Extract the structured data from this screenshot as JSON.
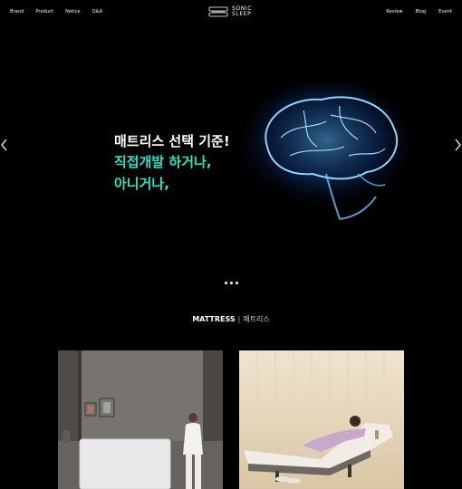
{
  "nav": {
    "left": [
      "Brand",
      "Product",
      "Notice",
      "Q&A"
    ],
    "right": [
      "Review",
      "Blog",
      "Event"
    ]
  },
  "logo": {
    "line1": "SONIC",
    "line2": "SLEEP"
  },
  "hero": {
    "line1": "매트리스 선택 기준!",
    "line2": "직접개발 하거나,",
    "line3": "아니거나,",
    "accent_color": "#32e0c4",
    "slide_indicator_count": 3
  },
  "section": {
    "title_en": "MATTRESS",
    "separator": "|",
    "title_ko": "매트리스"
  },
  "products": [
    {
      "image": "woman-standing-with-mattress"
    },
    {
      "image": "woman-lying-on-adjustable-bed"
    }
  ]
}
